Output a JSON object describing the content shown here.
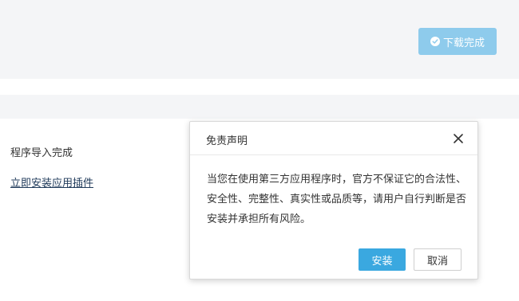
{
  "header": {
    "download_button_label": "下载完成",
    "download_button_icon": "check-circle-icon"
  },
  "main": {
    "status_text": "程序导入完成",
    "install_link_text": "立即安装应用插件"
  },
  "dialog": {
    "title": "免责声明",
    "close_icon": "close-icon",
    "body_text": "当您在使用第三方应用程序时，官方不保证它的合法性、安全性、完整性、真实性或品质等，请用户自行判断是否安装并承担所有风险。",
    "install_button_label": "安装",
    "cancel_button_label": "取消"
  },
  "colors": {
    "accent": "#3aa8e0",
    "accent_disabled": "#8ecbec",
    "band_background": "#f4f5f7",
    "link": "#1f3a5a"
  }
}
